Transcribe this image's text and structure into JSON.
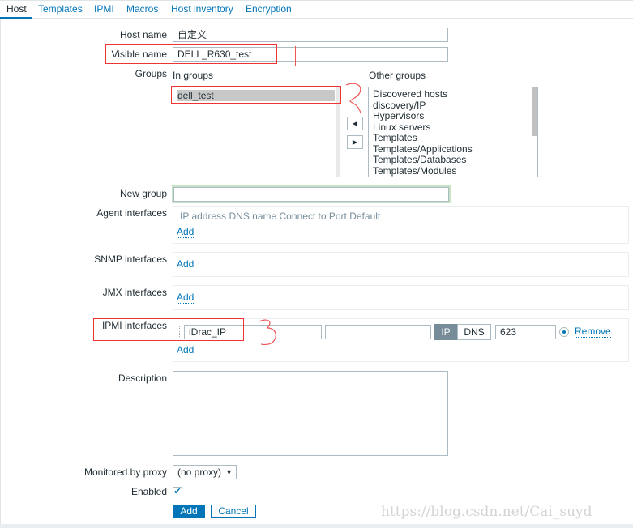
{
  "tabs": [
    {
      "label": "Host",
      "active": true
    },
    {
      "label": "Templates"
    },
    {
      "label": "IPMI"
    },
    {
      "label": "Macros"
    },
    {
      "label": "Host inventory"
    },
    {
      "label": "Encryption"
    }
  ],
  "form": {
    "host_name_label": "Host name",
    "host_name": "自定义",
    "visible_name_label": "Visible name",
    "visible_name": "DELL_R630_test",
    "groups_label": "Groups",
    "in_groups_label": "In groups",
    "in_groups": [
      "dell_test"
    ],
    "other_groups_label": "Other groups",
    "other_groups": [
      "Discovered hosts",
      "discovery/IP",
      "Hypervisors",
      "Linux servers",
      "Templates",
      "Templates/Applications",
      "Templates/Databases",
      "Templates/Modules"
    ],
    "new_group_label": "New group",
    "new_group": "",
    "agent_label": "Agent interfaces",
    "agent_headers": "IP address DNS name Connect to Port Default",
    "add": "Add",
    "snmp_label": "SNMP interfaces",
    "jmx_label": "JMX interfaces",
    "ipmi_label": "IPMI interfaces",
    "ipmi": {
      "ip": "iDrac_IP",
      "dns": "",
      "connect_ip": "IP",
      "connect_dns": "DNS",
      "port": "623",
      "remove": "Remove"
    },
    "description_label": "Description",
    "description": "",
    "proxy_label": "Monitored by proxy",
    "proxy": "(no proxy)",
    "enabled_label": "Enabled",
    "enabled": true,
    "add_button": "Add",
    "cancel_button": "Cancel"
  },
  "annotations": [
    "1",
    "2",
    "3"
  ],
  "watermark": "https://blog.csdn.net/Cai_suyd",
  "colors": {
    "accent": "#0275b8",
    "annotation": "#e33333",
    "selected_toggle": "#768d99"
  }
}
